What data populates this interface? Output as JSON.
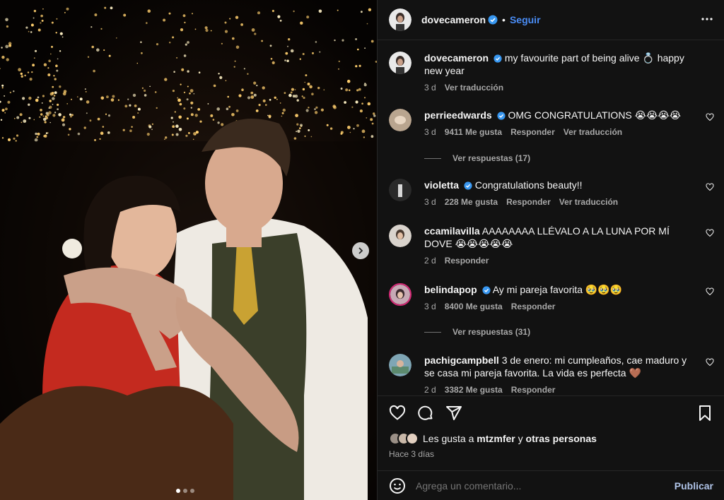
{
  "post": {
    "username": "dovecameron",
    "follow_label": "Seguir",
    "separator": "•",
    "caption_user": "dovecameron",
    "caption_text": "my favourite part of being alive 💍 happy new year",
    "caption_time": "3 d",
    "caption_translate": "Ver traducción"
  },
  "comments": [
    {
      "user": "perrieedwards",
      "verified": true,
      "text": "OMG CONGRATULATIONS 😭😭😭😭",
      "time": "3 d",
      "likes": "9411 Me gusta",
      "reply": "Responder",
      "translate": "Ver traducción",
      "replies": "Ver respuestas (17)"
    },
    {
      "user": "violetta",
      "verified": true,
      "text": "Congratulations beauty!!",
      "time": "3 d",
      "likes": "228 Me gusta",
      "reply": "Responder",
      "translate": "Ver traducción"
    },
    {
      "user": "ccamilavilla",
      "verified": false,
      "text": "AAAAAAAA LLÉVALO A LA LUNA POR MÍ DOVE 😭😭😭😭😭",
      "time": "2 d",
      "reply": "Responder"
    },
    {
      "user": "belindapop",
      "verified": true,
      "text": "Ay mi pareja favorita 🥹🥹🥹",
      "time": "3 d",
      "likes": "8400 Me gusta",
      "reply": "Responder",
      "replies": "Ver respuestas (31)"
    },
    {
      "user": "pachigcampbell",
      "verified": false,
      "text": "3 de enero: mi cumpleaños, cae maduro y se casa mi pareja favorita. La vida es perfecta 🤎",
      "time": "2 d",
      "likes": "3382 Me gusta",
      "reply": "Responder"
    }
  ],
  "likes_line": {
    "prefix": "Les gusta a",
    "user": "mtzmfer",
    "conj": "y",
    "others": "otras personas"
  },
  "posted_ago": "Hace 3 días",
  "add_comment": {
    "placeholder": "Agrega un comentario...",
    "publish_label": "Publicar"
  },
  "carousel": {
    "current": 1,
    "total": 3
  },
  "colors": {
    "accent": "#4a8df6",
    "panel_bg": "#121212",
    "verified": "#3897f0"
  }
}
